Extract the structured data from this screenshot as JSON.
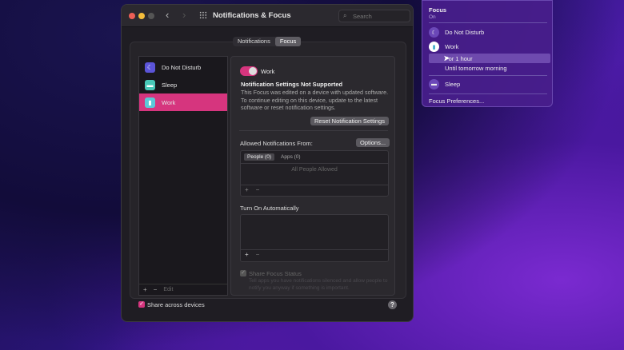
{
  "window": {
    "title": "Notifications & Focus",
    "search_placeholder": "Search",
    "tabs": [
      "Notifications",
      "Focus"
    ]
  },
  "focus_list": {
    "items": [
      {
        "label": "Do Not Disturb",
        "color": "#5b54d8"
      },
      {
        "label": "Sleep",
        "color": "#48c8b8"
      },
      {
        "label": "Work",
        "color": "#5cc8d8"
      }
    ],
    "add": "+",
    "remove": "−",
    "edit": "Edit"
  },
  "detail": {
    "toggle_label": "Work",
    "warning_title": "Notification Settings Not Supported",
    "warning_text": "This Focus was edited on a device with updated software. To continue editing on this device, update to the latest software or reset notification settings.",
    "reset_button": "Reset Notification Settings",
    "allowed_label": "Allowed Notifications From:",
    "options_button": "Options...",
    "subtabs": [
      "People (0)",
      "Apps (0)"
    ],
    "all_people": "All People Allowed",
    "add": "+",
    "remove": "−",
    "turn_on_label": "Turn On Automatically",
    "share_status_label": "Share Focus Status",
    "share_status_desc": "Tell apps you have notifications silenced and allow people to notify you anyway if something is important."
  },
  "footer": {
    "share_devices": "Share across devices",
    "help": "?"
  },
  "menu": {
    "title": "Focus",
    "status": "On",
    "items": [
      "Do Not Disturb",
      "Work",
      "Sleep"
    ],
    "work_options": [
      "For 1 hour",
      "Until tomorrow morning"
    ],
    "preferences": "Focus Preferences..."
  },
  "colors": {
    "accent": "#d6357e"
  }
}
